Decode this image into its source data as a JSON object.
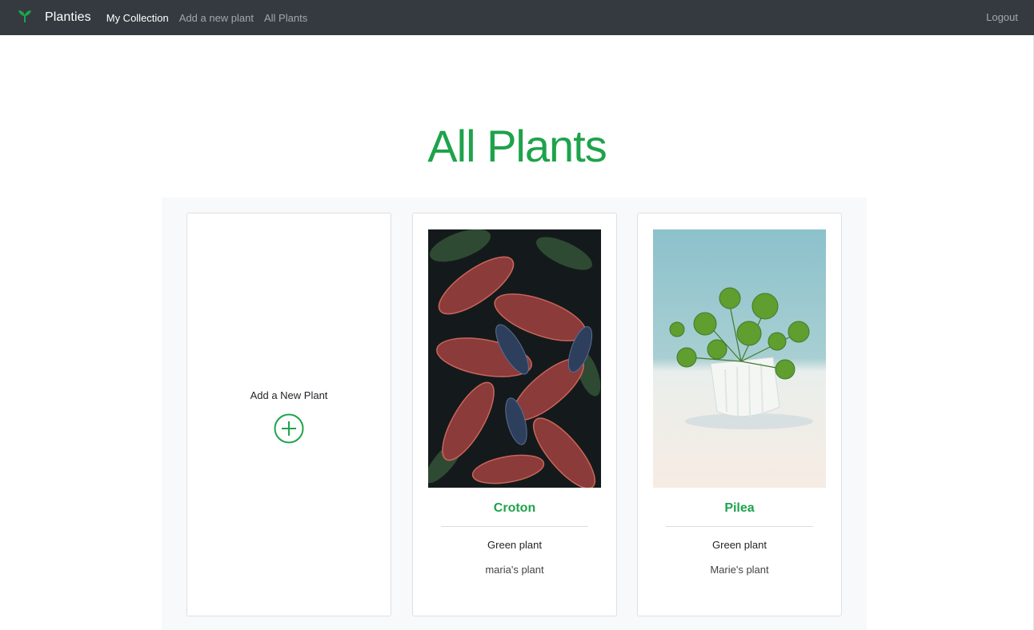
{
  "colors": {
    "navbar_bg": "#343a40",
    "accent_green": "#1ea34b",
    "grid_bg": "#f8f9fa"
  },
  "navbar": {
    "brand": "Planties",
    "brand_icon": "sprout-icon",
    "links": [
      {
        "label": "My Collection",
        "active": true
      },
      {
        "label": "Add a new plant",
        "active": false
      },
      {
        "label": "All Plants",
        "active": false
      }
    ],
    "logout": "Logout"
  },
  "page": {
    "title": "All Plants"
  },
  "add_card": {
    "label": "Add a New Plant",
    "icon": "plus-circle-icon"
  },
  "plants": [
    {
      "name": "Croton",
      "type": "Green plant",
      "owner": "maria's plant",
      "image": "croton-leaves-photo"
    },
    {
      "name": "Pilea",
      "type": "Green plant",
      "owner": "Marie's plant",
      "image": "pilea-pot-photo"
    }
  ]
}
